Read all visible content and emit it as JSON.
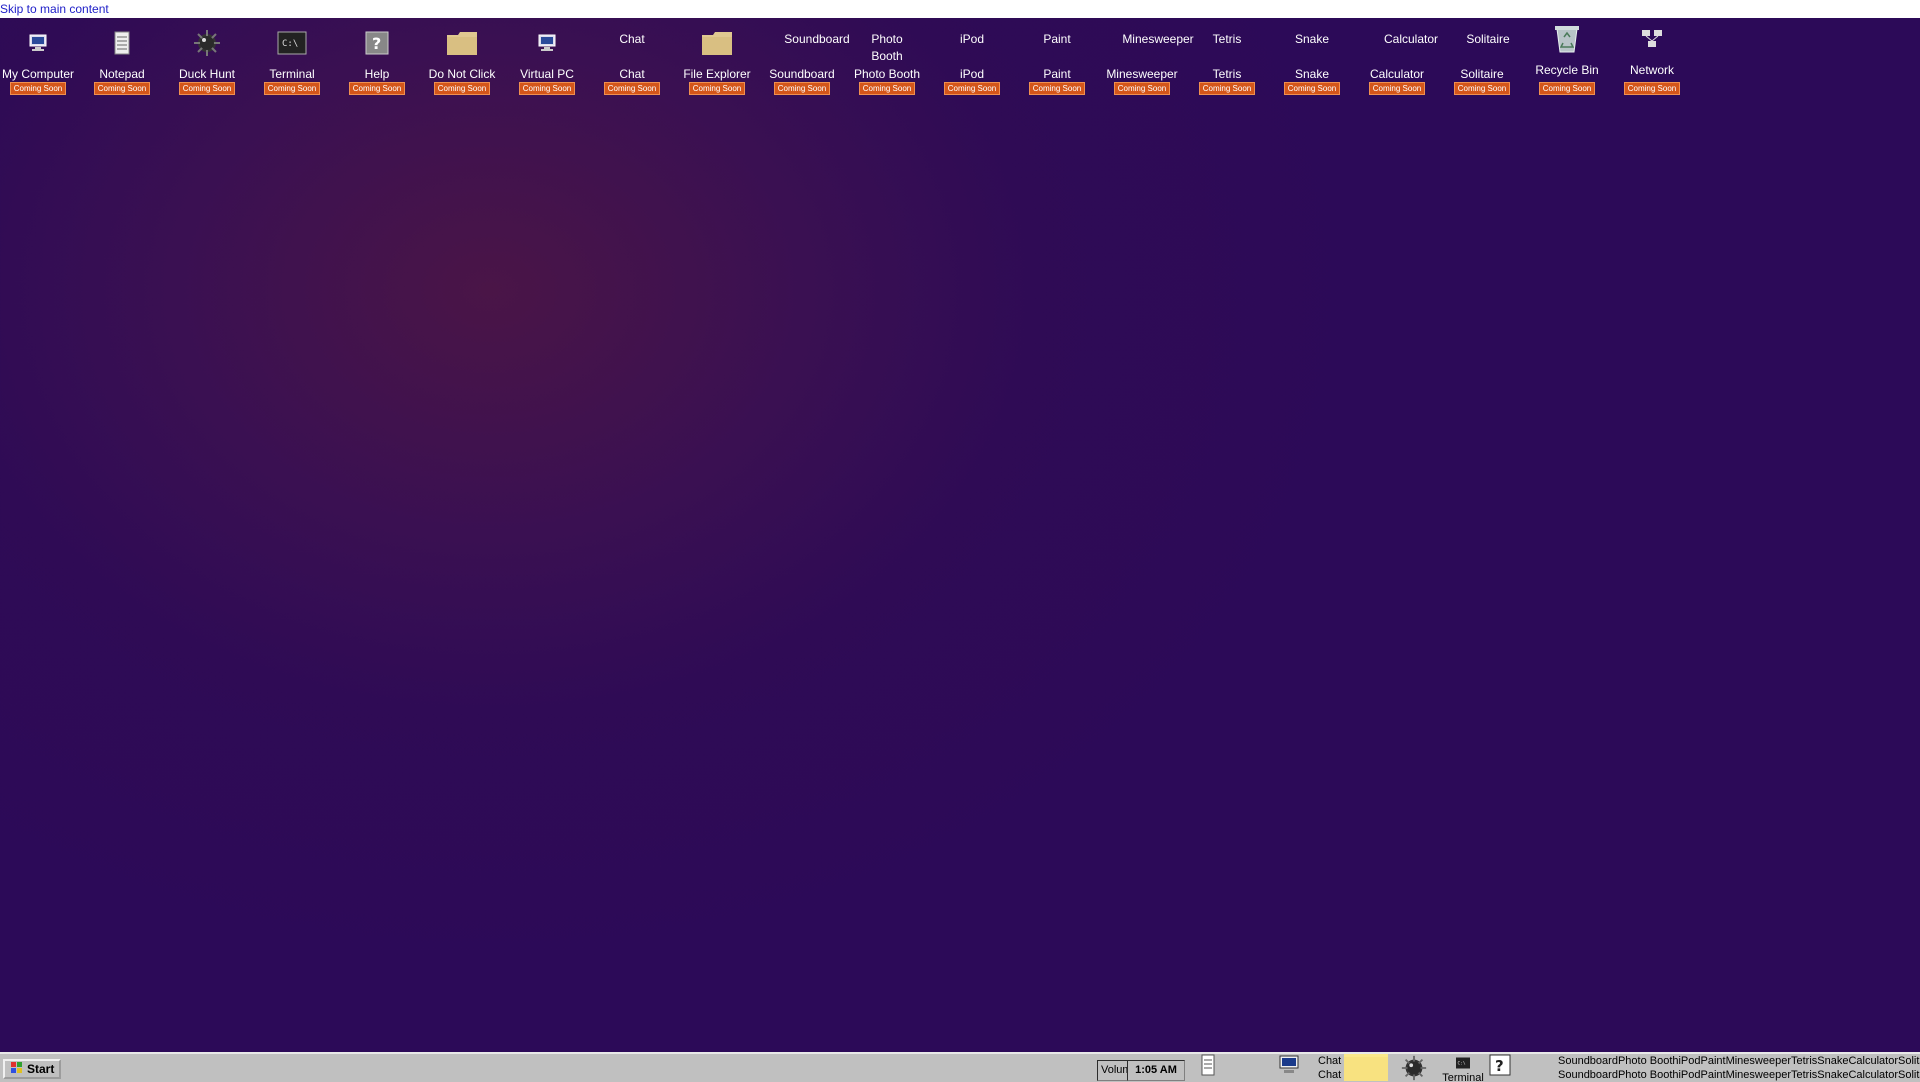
{
  "skip_link": "Skip to main content",
  "badge_text": "Coming Soon",
  "desktop_icons": [
    {
      "label": "My Computer",
      "icon": "computer-icon",
      "top": ""
    },
    {
      "label": "Notepad",
      "icon": "notepad-icon",
      "top": ""
    },
    {
      "label": "Duck Hunt",
      "icon": "duck-hunt-icon",
      "top": ""
    },
    {
      "label": "Terminal",
      "icon": "terminal-icon",
      "top": ""
    },
    {
      "label": "Help",
      "icon": "help-icon",
      "top": ""
    },
    {
      "label": "Do Not Click",
      "icon": "folder-icon",
      "top": ""
    },
    {
      "label": "Virtual PC",
      "icon": "virtual-pc-icon",
      "top": ""
    },
    {
      "label": "Chat",
      "icon": "",
      "top": "Chat"
    },
    {
      "label": "File Explorer",
      "icon": "folder-icon",
      "top": ""
    },
    {
      "label": "Soundboard",
      "icon": "",
      "top": "Soundboard"
    },
    {
      "label": "Photo Booth",
      "icon": "",
      "top": "Photo Booth"
    },
    {
      "label": "iPod",
      "icon": "",
      "top": "iPod"
    },
    {
      "label": "Paint",
      "icon": "",
      "top": "Paint"
    },
    {
      "label": "Minesweeper",
      "icon": "",
      "top": "Minesweeper"
    },
    {
      "label": "Tetris",
      "icon": "",
      "top": "Tetris"
    },
    {
      "label": "Snake",
      "icon": "",
      "top": "Snake"
    },
    {
      "label": "Calculator",
      "icon": "",
      "top": "Calculator"
    },
    {
      "label": "Solitaire",
      "icon": "",
      "top": "Solitaire"
    },
    {
      "label": "Recycle Bin",
      "icon": "recycle-bin-icon",
      "top": ""
    },
    {
      "label": "Network",
      "icon": "network-icon",
      "top": ""
    }
  ],
  "taskbar": {
    "start_label": "Start",
    "volume_label": "Volume",
    "clock": "1:05 AM",
    "chat_label": "Chat",
    "terminal_label": "Terminal",
    "stack_text": "SoundboardPhoto BoothiPodPaintMinesweeperTetrisSnakeCalculatorSolitaire"
  },
  "colors": {
    "badge": "#d4561a",
    "desktop": "#2f0b55",
    "taskbar": "#c0c0c0"
  }
}
